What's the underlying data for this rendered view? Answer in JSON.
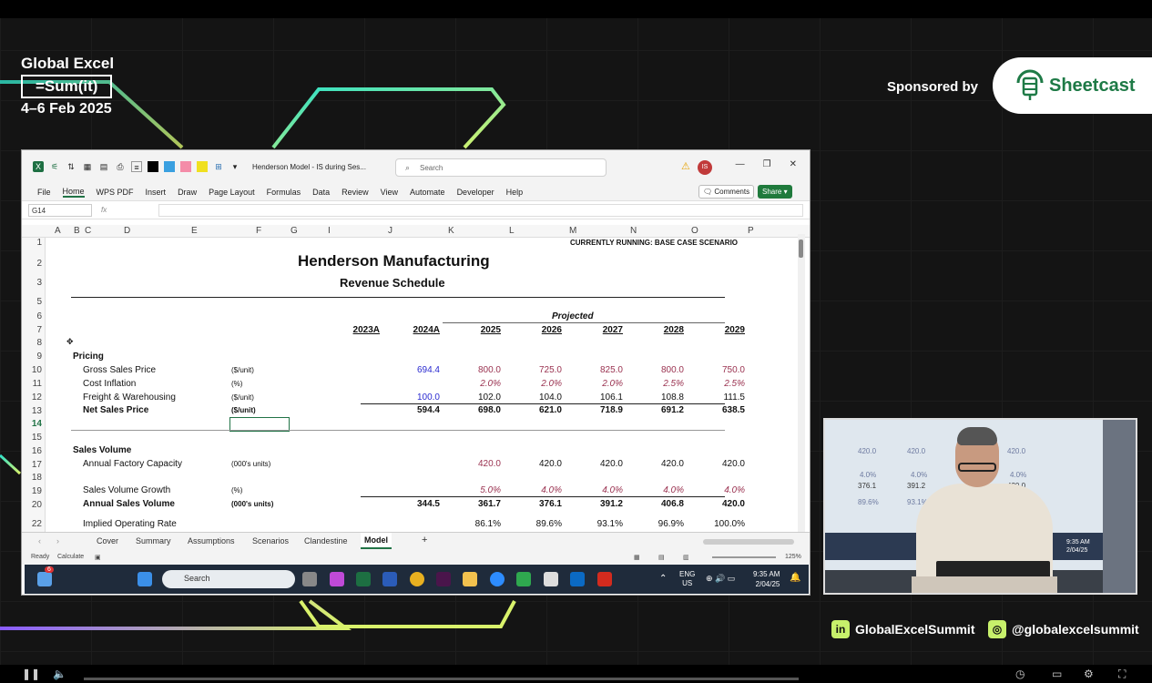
{
  "event": {
    "line1": "Global Excel",
    "line2": "=Sum(it)",
    "dates": "4–6 Feb 2025",
    "sponsored_by": "Sponsored by",
    "sponsor_name": "Sheetcast",
    "linkedin": "GlobalExcelSummit",
    "instagram": "@globalexcelsummit"
  },
  "window": {
    "title": "Henderson Model - IS during Ses...",
    "search_placeholder": "Search",
    "user_initials": "IS",
    "menu": [
      "File",
      "Home",
      "WPS PDF",
      "Insert",
      "Draw",
      "Page Layout",
      "Formulas",
      "Data",
      "Review",
      "View",
      "Automate",
      "Developer",
      "Help"
    ],
    "comments_label": "Comments",
    "share_label": "Share",
    "name_box": "G14",
    "fx_label": "fx"
  },
  "columns": [
    "A",
    "B",
    "C",
    "D",
    "E",
    "F",
    "G",
    "I",
    "J",
    "K",
    "L",
    "M",
    "N",
    "O",
    "P"
  ],
  "rows": [
    "1",
    "2",
    "3",
    "5",
    "6",
    "7",
    "8",
    "9",
    "10",
    "11",
    "12",
    "13",
    "14",
    "15",
    "16",
    "17",
    "18",
    "19",
    "20",
    "22"
  ],
  "sheet": {
    "scenario_banner": "CURRENTLY RUNNING: BASE CASE SCENARIO",
    "company": "Henderson Manufacturing",
    "schedule": "Revenue Schedule",
    "projected": "Projected",
    "years": [
      "2023A",
      "2024A",
      "2025",
      "2026",
      "2027",
      "2028",
      "2029"
    ],
    "pricing_header": "Pricing",
    "gross_sales_price": {
      "label": "Gross Sales Price",
      "unit": "($/unit)",
      "values": [
        "694.4",
        "800.0",
        "725.0",
        "825.0",
        "800.0",
        "750.0"
      ]
    },
    "cost_inflation": {
      "label": "Cost Inflation",
      "unit": "(%)",
      "values": [
        "2.0%",
        "2.0%",
        "2.0%",
        "2.5%",
        "2.5%"
      ]
    },
    "freight": {
      "label": "Freight & Warehousing",
      "unit": "($/unit)",
      "values": [
        "100.0",
        "102.0",
        "104.0",
        "106.1",
        "108.8",
        "111.5"
      ]
    },
    "net_sales_price": {
      "label": "Net Sales Price",
      "unit": "($/unit)",
      "values": [
        "594.4",
        "698.0",
        "621.0",
        "718.9",
        "691.2",
        "638.5"
      ]
    },
    "sales_volume_header": "Sales Volume",
    "capacity": {
      "label": "Annual Factory Capacity",
      "unit": "(000's units)",
      "values": [
        "420.0",
        "420.0",
        "420.0",
        "420.0",
        "420.0"
      ]
    },
    "volume_growth": {
      "label": "Sales Volume Growth",
      "unit": "(%)",
      "values": [
        "5.0%",
        "4.0%",
        "4.0%",
        "4.0%",
        "4.0%"
      ]
    },
    "annual_volume": {
      "label": "Annual Sales Volume",
      "unit": "(000's units)",
      "values": [
        "344.5",
        "361.7",
        "376.1",
        "391.2",
        "406.8",
        "420.0"
      ]
    },
    "operating_rate": {
      "label": "Implied Operating Rate",
      "values": [
        "86.1%",
        "89.6%",
        "93.1%",
        "96.9%",
        "100.0%"
      ]
    }
  },
  "tabs": [
    "Cover",
    "Summary",
    "Assumptions",
    "Scenarios",
    "Clandestine",
    "Model"
  ],
  "status": {
    "ready": "Ready",
    "calculate": "Calculate",
    "zoom": "125%"
  },
  "taskbar": {
    "weather_badge": "6",
    "search": "Search",
    "lang1": "ENG",
    "lang2": "US",
    "time": "9:35 AM",
    "date": "2/04/25"
  },
  "webcam": {
    "nums_a": [
      "420.0",
      "420.0",
      "420.0"
    ],
    "nums_b": [
      "4.0%",
      "4.0%",
      "4.0%"
    ],
    "nums_c": [
      "376.1",
      "391.2",
      "420.0"
    ],
    "nums_d": [
      "89.6%",
      "93.1%"
    ],
    "time": "9:35 AM",
    "date": "2/04/25"
  },
  "colors": {
    "excel_green": "#217346",
    "input_blue": "#2a2ad0",
    "projection_maroon": "#9a3250",
    "neon": "#c7f06b"
  }
}
